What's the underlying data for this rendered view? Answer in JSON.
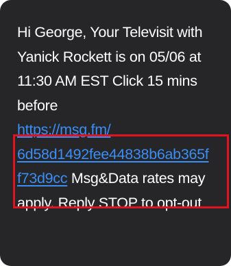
{
  "message": {
    "line1": "Hi George, Your Televisit with",
    "line2": "Yanick Rockett is on 05/06 at",
    "line3": "11:30 AM EST Click 15 mins",
    "line4": "before",
    "link_line1": "https://msg.fm/",
    "link_line2": "6d58d1492fee44838b6ab365f",
    "link_line3": "f73d9cc",
    "after_link": " Msg&Data rates may",
    "line8": "apply. Reply STOP to opt-out"
  },
  "colors": {
    "bubble_background": "#262628",
    "text": "#ffffff",
    "link": "#3a8ef6",
    "highlight_border": "#e0141e"
  }
}
